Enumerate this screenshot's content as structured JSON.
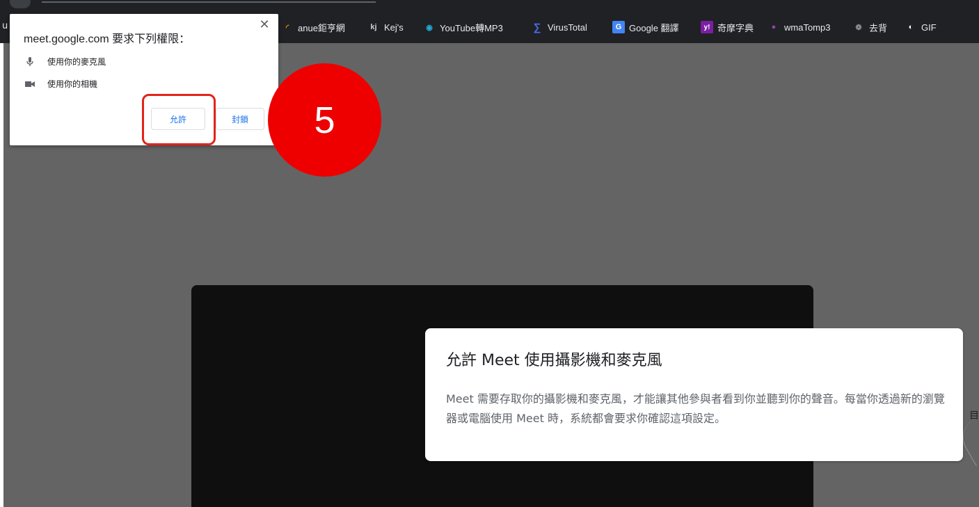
{
  "browser": {
    "left_fragment": "u",
    "bookmarks": [
      {
        "label": "anue鉅亨網",
        "icon": "anue-icon",
        "glyph": "◜",
        "color": "#f29900"
      },
      {
        "label": "Kej's",
        "icon": "kej-icon",
        "glyph": "kj",
        "color": "#cfcfcf"
      },
      {
        "label": "YouTube轉MP3",
        "icon": "ytmp3-icon",
        "glyph": "◉",
        "color": "#23a6d5"
      },
      {
        "label": "VirusTotal",
        "icon": "virustotal-icon",
        "glyph": "∑",
        "color": "#4a6cf7"
      },
      {
        "label": "Google 翻譯",
        "icon": "google-translate-icon",
        "glyph": "G",
        "color": "#4285f4"
      },
      {
        "label": "奇摩字典",
        "icon": "yahoo-icon",
        "glyph": "y!",
        "color": "#7b1fa2"
      },
      {
        "label": "wmaTomp3",
        "icon": "wmatomp3-icon",
        "glyph": "●",
        "color": "#8e44ad"
      },
      {
        "label": "去背",
        "icon": "removebg-icon",
        "glyph": "❁",
        "color": "#888888"
      },
      {
        "label": "GIF",
        "icon": "gif-icon",
        "glyph": "◐",
        "color": "#ffffff"
      }
    ]
  },
  "permission_popup": {
    "title": "meet.google.com 要求下列權限：",
    "close_icon": "close-icon",
    "items": [
      {
        "label": "使用你的麥克風",
        "icon": "microphone-icon"
      },
      {
        "label": "使用你的相機",
        "icon": "camera-icon"
      }
    ],
    "allow_label": "允許",
    "block_label": "封鎖"
  },
  "step_marker": {
    "number": "5",
    "color": "#ee0000"
  },
  "info_card": {
    "title": "允許 Meet 使用攝影機和麥克風",
    "body": "Meet 需要存取你的攝影機和麥克風，才能讓其他參與者看到你並聽到你的聲音。每當你透過新的瀏覽器或電腦使用 Meet 時，系統都會要求你確認這項設定。"
  },
  "page": {
    "right_edge_char": "目"
  },
  "colors": {
    "highlight": "#e2231a",
    "accent": "#1a73e8",
    "page_bg": "#646464"
  }
}
